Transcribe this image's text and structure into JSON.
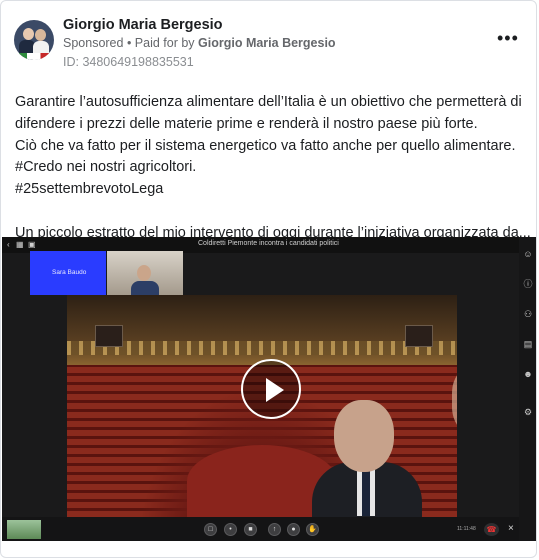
{
  "post": {
    "author_name": "Giorgio Maria Bergesio",
    "sponsored_label": "Sponsored",
    "paid_by_prefix": " • Paid for by ",
    "paid_by_name": "Giorgio Maria Bergesio",
    "ad_id": "ID: 3480649198835531",
    "more_options": "•••",
    "lines": [
      "Garantire l’autosufficienza alimentare dell’Italia è un obiettivo che permetterà di",
      "difendere i prezzi delle materie prime e renderà il nostro paese più forte.",
      "Ciò che va fatto per il sistema energetico va fatto anche per quello alimentare.",
      "#Credo nei nostri agricoltori.",
      "#25settembrevotoLega",
      "Un piccolo estratto del mio intervento di oggi durante l’iniziativa organizzata da..."
    ]
  },
  "video": {
    "meeting_title": "Coldiretti Piemonte incontra i candidati politici",
    "participant_tile_label": "Sara Baudo",
    "play_icon": "play-icon",
    "timecode": "11:11:48",
    "colors": {
      "tile_blue": "#2a3cff",
      "background": "#1a1a1b",
      "hangup_red": "#e33333"
    }
  }
}
